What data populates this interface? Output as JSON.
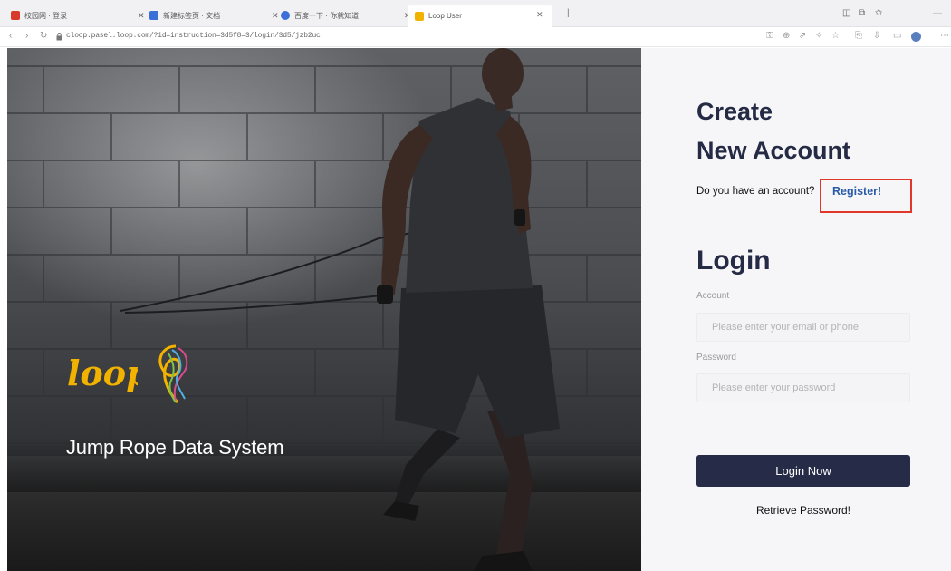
{
  "browser": {
    "tabs": [
      {
        "title": "校园网 · 登录",
        "icon_color": "#d83a2c"
      },
      {
        "title": "新建标签页 · 文档",
        "icon_color": "#3b6fd8"
      },
      {
        "title": "百度一下 · 你就知道",
        "icon_color": "#3b6fd8"
      },
      {
        "title": "Loop User",
        "icon_color": "#f0b400",
        "active": true
      }
    ],
    "url": "cloop.pasel.loop.com/?id=instruction=3d5f8=3/login/3d5/jzb2uc",
    "nav_icons": [
      "back-icon",
      "forward-icon",
      "reload-icon",
      "lock-icon"
    ],
    "toolbar_icons": [
      "key-icon",
      "zoom-icon",
      "share-icon",
      "extensions-icon",
      "favorite-icon",
      "collections-icon",
      "downloads-icon",
      "screenshot-icon",
      "profile-icon",
      "more-icon"
    ]
  },
  "hero": {
    "logo_text": "loop",
    "title": "Jump Rope Data System"
  },
  "signup": {
    "heading_line1": "Create",
    "heading_line2": "New Account",
    "question": "Do you have an account?",
    "register_link": "Register!",
    "highlight_color": "#e0382b"
  },
  "login": {
    "heading": "Login",
    "account_label": "Account",
    "account_placeholder": "Please enter your email or phone",
    "account_value": "",
    "password_label": "Password",
    "password_placeholder": "Please enter your password",
    "password_value": "",
    "submit_label": "Login Now",
    "retrieve_label": "Retrieve Password!"
  },
  "colors": {
    "navy": "#252a45",
    "link": "#2a5aa8",
    "panel_bg": "#f6f6f8"
  }
}
